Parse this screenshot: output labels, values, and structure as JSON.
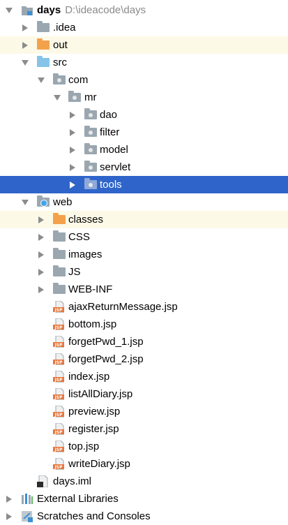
{
  "tree": {
    "root": {
      "name": "days",
      "path": "D:\\ideacode\\days"
    },
    "idea": "idea_label",
    "items": {
      "idea": ".idea",
      "out": "out",
      "src": "src",
      "com": "com",
      "mr": "mr",
      "dao": "dao",
      "filter": "filter",
      "model": "model",
      "servlet": "servlet",
      "tools": "tools",
      "web": "web",
      "classes": "classes",
      "css": "CSS",
      "images": "images",
      "js": "JS",
      "webinf": "WEB-INF",
      "f1": "ajaxReturnMessage.jsp",
      "f2": "bottom.jsp",
      "f3": "forgetPwd_1.jsp",
      "f4": "forgetPwd_2.jsp",
      "f5": "index.jsp",
      "f6": "listAllDiary.jsp",
      "f7": "preview.jsp",
      "f8": "register.jsp",
      "f9": "top.jsp",
      "f10": "writeDiary.jsp",
      "iml": "days.iml",
      "extlib": "External Libraries",
      "scratches": "Scratches and Consoles"
    },
    "jsp_badge": "JSP"
  },
  "colors": {
    "selection": "#2f65ca",
    "excluded_highlight": "#fcfae7",
    "folder_gray": "#9aa7b0",
    "folder_orange": "#f4a14b",
    "folder_source": "#85c4e8"
  }
}
